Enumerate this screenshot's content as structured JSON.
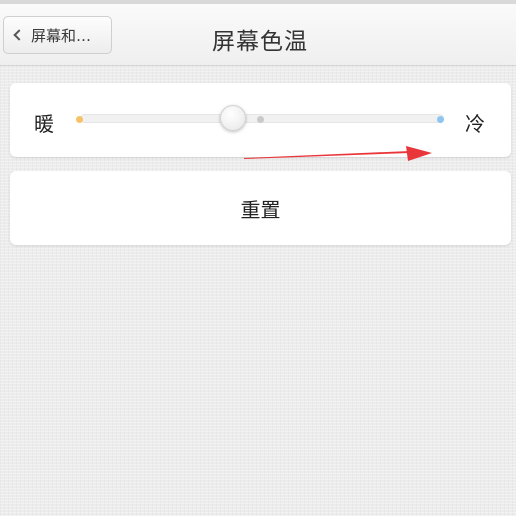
{
  "nav": {
    "back_label": "屏幕和…",
    "title": "屏幕色温"
  },
  "slider": {
    "warm_label": "暖",
    "cool_label": "冷",
    "value": 0.42,
    "colors": {
      "warm": "#f5c266",
      "middle": "#c9c9c9",
      "cool": "#8ec4f0"
    }
  },
  "reset": {
    "label": "重置"
  },
  "annotation": {
    "arrow_color": "#e8363a"
  }
}
